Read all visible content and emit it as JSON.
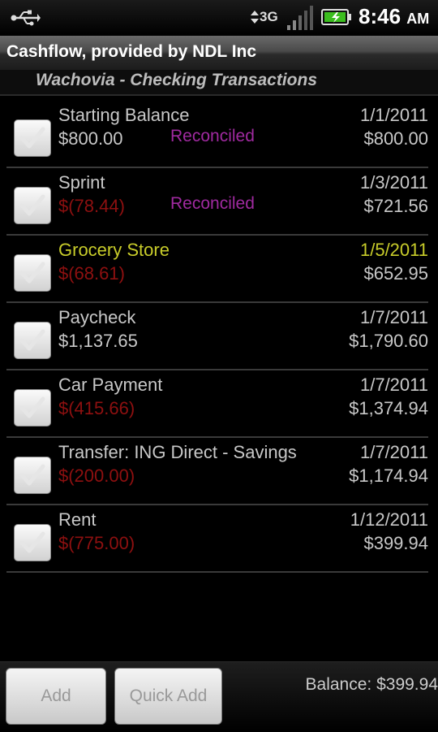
{
  "status_bar": {
    "network": "3G",
    "time": "8:46",
    "ampm": "AM",
    "icons": [
      "usb-icon",
      "data-arrows-icon",
      "signal-icon",
      "battery-charging-icon"
    ]
  },
  "app": {
    "title": "Cashflow, provided by NDL Inc"
  },
  "account": {
    "subtitle": "Wachovia - Checking Transactions"
  },
  "transactions": [
    {
      "payee": "Starting Balance",
      "amount": "$800.00",
      "status": "Reconciled",
      "date": "1/1/2011",
      "balance": "$800.00",
      "negative": false
    },
    {
      "payee": "Sprint",
      "amount": "$(78.44)",
      "status": "Reconciled",
      "date": "1/3/2011",
      "balance": "$721.56",
      "negative": true
    },
    {
      "payee": "Grocery Store",
      "amount": "$(68.61)",
      "status": "",
      "date": "1/5/2011",
      "balance": "$652.95",
      "negative": true
    },
    {
      "payee": "Paycheck",
      "amount": "$1,137.65",
      "status": "",
      "date": "1/7/2011",
      "balance": "$1,790.60",
      "negative": false
    },
    {
      "payee": "Car Payment",
      "amount": "$(415.66)",
      "status": "",
      "date": "1/7/2011",
      "balance": "$1,374.94",
      "negative": true
    },
    {
      "payee": "Transfer: ING Direct - Savings",
      "amount": "$(200.00)",
      "status": "",
      "date": "1/7/2011",
      "balance": "$1,174.94",
      "negative": true
    },
    {
      "payee": "Rent",
      "amount": "$(775.00)",
      "status": "",
      "date": "1/12/2011",
      "balance": "$399.94",
      "negative": true
    }
  ],
  "footer": {
    "add_label": "Add",
    "quick_add_label": "Quick Add",
    "balance_text": "Balance: $399.94"
  },
  "colors": {
    "negative_amount": "#8e1010",
    "reconciled": "#a02aa0",
    "highlight_row": "#c8cc2a"
  }
}
